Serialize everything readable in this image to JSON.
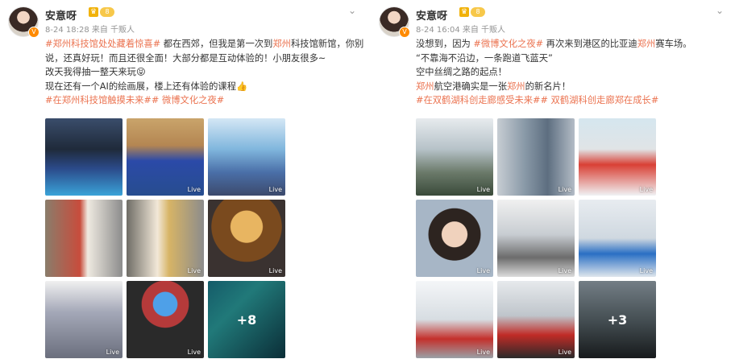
{
  "posts": [
    {
      "username": "安意呀",
      "meta": "8-24 18:28  来自 千贩人",
      "lines": [
        [
          {
            "t": "tag",
            "v": "#郑州科技馆处处藏着惊喜#"
          },
          {
            "t": "text",
            "v": " 都在西郊，但我是第一次到"
          },
          {
            "t": "hl",
            "v": "郑州"
          },
          {
            "t": "text",
            "v": "科技馆新馆，你别"
          }
        ],
        [
          {
            "t": "text",
            "v": "说，还真好玩！而且还很全面！大部分都是互动体验的！小朋友很多~"
          }
        ],
        [
          {
            "t": "text",
            "v": "改天我得抽一整天来玩😝"
          }
        ],
        [
          {
            "t": "text",
            "v": "现在还有一个AI的绘画展，楼上还有体验的课程👍"
          }
        ],
        [
          {
            "t": "tag",
            "v": "#在郑州科技馆触摸未来## 微博文化之夜#"
          }
        ]
      ],
      "tiles": [
        {
          "name": "photo-science-museum-facade",
          "live": ""
        },
        {
          "name": "photo-exhibit-screen",
          "live": "Live"
        },
        {
          "name": "photo-dome-hall",
          "live": "Live"
        },
        {
          "name": "photo-atrium-red",
          "live": ""
        },
        {
          "name": "photo-atrium-gold",
          "live": "Live"
        },
        {
          "name": "photo-tree-sculpture",
          "live": "Live"
        },
        {
          "name": "photo-visitors",
          "live": "Live"
        },
        {
          "name": "photo-tube-exhibit",
          "live": "Live"
        },
        {
          "name": "photo-underwater",
          "live": "",
          "more": "+8"
        }
      ]
    },
    {
      "username": "安意呀",
      "meta": "8-24 16:04  来自 千贩人",
      "lines": [
        [
          {
            "t": "text",
            "v": "没想到，因为 "
          },
          {
            "t": "tag",
            "v": "#微博文化之夜#"
          },
          {
            "t": "text",
            "v": " 再次来到港区的比亚迪"
          },
          {
            "t": "hl",
            "v": "郑州"
          },
          {
            "t": "text",
            "v": "赛车场。"
          }
        ],
        [
          {
            "t": "text",
            "v": "“不靠海不沿边，一条跑道飞蓝天”"
          }
        ],
        [
          {
            "t": "text",
            "v": "空中丝绸之路的起点！"
          }
        ],
        [
          {
            "t": "hl",
            "v": "郑州"
          },
          {
            "t": "text",
            "v": "航空港确实是一张"
          },
          {
            "t": "hl",
            "v": "郑州"
          },
          {
            "t": "text",
            "v": "的新名片！"
          }
        ],
        [
          {
            "t": "tag",
            "v": "#在双鹤湖科创走廊感受未来## 双鹤湖科创走廊郑在成长#"
          }
        ]
      ],
      "tiles": [
        {
          "name": "photo-city-model",
          "live": "Live"
        },
        {
          "name": "photo-tower-model",
          "live": "Live"
        },
        {
          "name": "photo-ship-model",
          "live": "Live"
        },
        {
          "name": "photo-selfie",
          "live": "Live"
        },
        {
          "name": "photo-robot-arm",
          "live": "Live"
        },
        {
          "name": "photo-exhibit-display",
          "live": "Live"
        },
        {
          "name": "photo-red-car-showroom",
          "live": "Live"
        },
        {
          "name": "photo-red-supercar",
          "live": "Live"
        },
        {
          "name": "photo-car-water",
          "live": "",
          "more": "+3"
        }
      ]
    }
  ],
  "icons": {
    "vip": "V",
    "crown": "♛",
    "level": "8",
    "menu": "⌄"
  }
}
